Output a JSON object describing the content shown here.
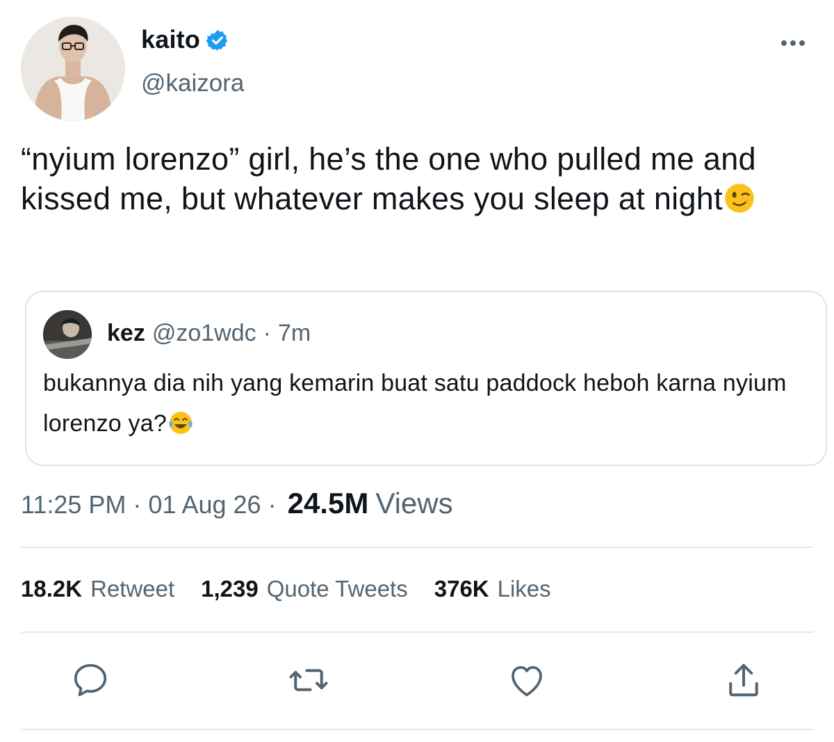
{
  "author": {
    "display_name": "kaito",
    "handle": "@kaizora",
    "verified": true
  },
  "tweet": {
    "text": "“nyium lorenzo” girl, he’s the one who pulled me and kissed me, but whatever makes you sleep at night",
    "emoji": "winking-face"
  },
  "quoted_tweet": {
    "display_name": "kez",
    "handle": "@zo1wdc",
    "separator": "·",
    "time": "7m",
    "text": "bukannya dia nih yang kemarin buat satu paddock heboh karna nyium lorenzo ya?",
    "emoji": "face-with-tears-of-joy"
  },
  "meta": {
    "time": "11:25 PM",
    "sep1": "·",
    "date": "01 Aug 26",
    "sep2": "·",
    "views_count": "24.5M",
    "views_label": "Views"
  },
  "stats": {
    "retweets_count": "18.2K",
    "retweets_label": "Retweet",
    "quotes_count": "1,239",
    "quotes_label": "Quote Tweets",
    "likes_count": "376K",
    "likes_label": "Likes"
  },
  "colors": {
    "text_primary": "#0f1419",
    "text_secondary": "#536471",
    "verified_blue": "#1d9bf0",
    "border": "#dfe3e6"
  },
  "icons": [
    "verified-icon",
    "more-icon",
    "reply-icon",
    "retweet-icon",
    "like-icon",
    "share-icon"
  ]
}
